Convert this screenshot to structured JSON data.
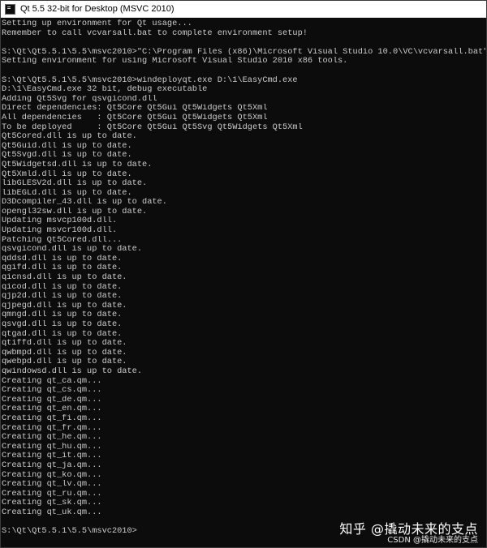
{
  "window": {
    "title": "Qt 5.5 32-bit for Desktop (MSVC 2010)",
    "icon": "console-icon"
  },
  "colors": {
    "background": "#0c0c0c",
    "text": "#cccccc",
    "titlebar": "#ffffff"
  },
  "console": {
    "lines": [
      "Setting up environment for Qt usage...",
      "Remember to call vcvarsall.bat to complete environment setup!",
      "",
      "S:\\Qt\\Qt5.5.1\\5.5\\msvc2010>\"C:\\Program Files (x86)\\Microsoft Visual Studio 10.0\\VC\\vcvarsall.bat\"",
      "Setting environment for using Microsoft Visual Studio 2010 x86 tools.",
      "",
      "S:\\Qt\\Qt5.5.1\\5.5\\msvc2010>windeployqt.exe D:\\1\\EasyCmd.exe",
      "D:\\1\\EasyCmd.exe 32 bit, debug executable",
      "Adding Qt5Svg for qsvgicond.dll",
      "Direct dependencies: Qt5Core Qt5Gui Qt5Widgets Qt5Xml",
      "All dependencies   : Qt5Core Qt5Gui Qt5Widgets Qt5Xml",
      "To be deployed     : Qt5Core Qt5Gui Qt5Svg Qt5Widgets Qt5Xml",
      "Qt5Cored.dll is up to date.",
      "Qt5Guid.dll is up to date.",
      "Qt5Svgd.dll is up to date.",
      "Qt5Widgetsd.dll is up to date.",
      "Qt5Xmld.dll is up to date.",
      "libGLESV2d.dll is up to date.",
      "libEGLd.dll is up to date.",
      "D3Dcompiler_43.dll is up to date.",
      "opengl32sw.dll is up to date.",
      "Updating msvcp100d.dll.",
      "Updating msvcr100d.dll.",
      "Patching Qt5Cored.dll...",
      "qsvgicond.dll is up to date.",
      "qddsd.dll is up to date.",
      "qgifd.dll is up to date.",
      "qicnsd.dll is up to date.",
      "qicod.dll is up to date.",
      "qjp2d.dll is up to date.",
      "qjpegd.dll is up to date.",
      "qmngd.dll is up to date.",
      "qsvgd.dll is up to date.",
      "qtgad.dll is up to date.",
      "qtiffd.dll is up to date.",
      "qwbmpd.dll is up to date.",
      "qwebpd.dll is up to date.",
      "qwindowsd.dll is up to date.",
      "Creating qt_ca.qm...",
      "Creating qt_cs.qm...",
      "Creating qt_de.qm...",
      "Creating qt_en.qm...",
      "Creating qt_fi.qm...",
      "Creating qt_fr.qm...",
      "Creating qt_he.qm...",
      "Creating qt_hu.qm...",
      "Creating qt_it.qm...",
      "Creating qt_ja.qm...",
      "Creating qt_ko.qm...",
      "Creating qt_lv.qm...",
      "Creating qt_ru.qm...",
      "Creating qt_sk.qm...",
      "Creating qt_uk.qm...",
      "",
      "S:\\Qt\\Qt5.5.1\\5.5\\msvc2010>"
    ]
  },
  "watermark": {
    "text": "知乎 @撬动未来的支点",
    "csdn": "CSDN @撬动未来的支点"
  }
}
